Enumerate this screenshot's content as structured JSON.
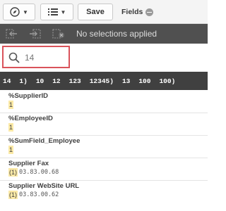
{
  "toolbar": {
    "compass_icon": "compass-icon",
    "list_icon": "list-icon",
    "save_label": "Save",
    "fields_label": "Fields"
  },
  "selection_bar": {
    "back_icon": "step-back-icon",
    "forward_icon": "step-forward-icon",
    "clear_icon": "clear-selections-icon",
    "text": "No selections applied"
  },
  "search": {
    "value": "14"
  },
  "tokens": [
    "14",
    "1)",
    "10",
    "12",
    "123",
    "12345)",
    "13",
    "100",
    "100)"
  ],
  "results": [
    {
      "title": "%SupplierID",
      "match": "1",
      "rest": ""
    },
    {
      "title": "%EmployeeID",
      "match": "1",
      "rest": ""
    },
    {
      "title": "%SumField_Employee",
      "match": "1",
      "rest": ""
    },
    {
      "title": "Supplier Fax",
      "match": "(1)",
      "rest": "03.83.00.68"
    },
    {
      "title": "Supplier WebSite URL",
      "match": "(1)",
      "rest": "03.83.00.62"
    }
  ],
  "colors": {
    "highlight": "#fbe9a6",
    "search_border": "#d9535b",
    "selection_bar": "#505050",
    "token_bar": "#404040"
  }
}
